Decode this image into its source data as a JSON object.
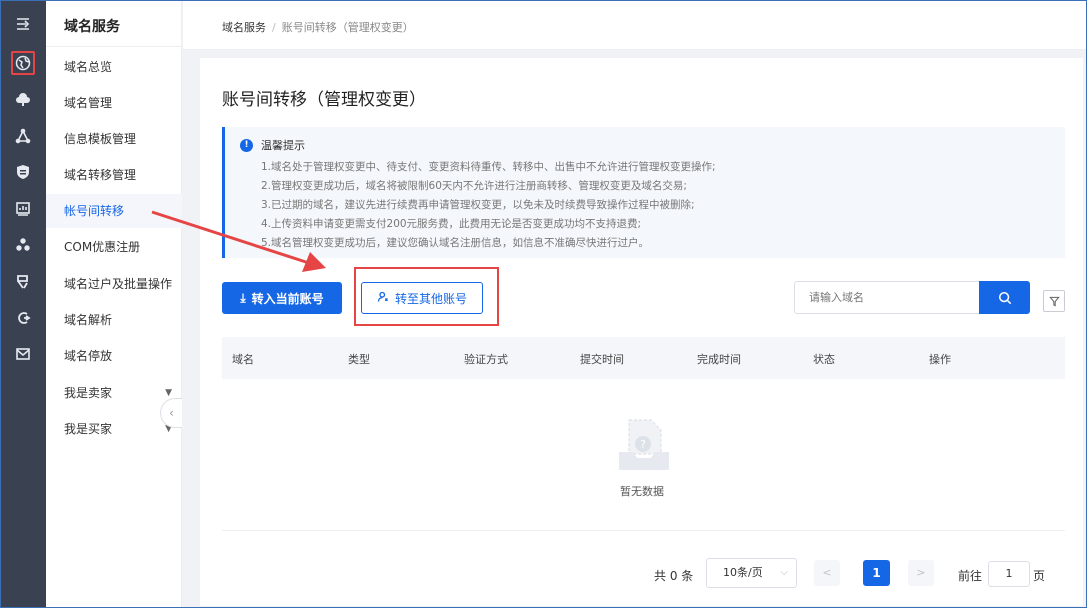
{
  "colors": {
    "rail_bg": "#3a4251",
    "accent": "#1667e6",
    "annotation": "#e64545"
  },
  "rail": {
    "icons": [
      "menu-expand-icon",
      "domain-globe-icon",
      "cloud-icon",
      "network-icon",
      "shield-icon",
      "monitor-icon",
      "cluster-icon",
      "server-icon",
      "cdn-icon",
      "mail-icon"
    ]
  },
  "sidebar": {
    "title": "域名服务",
    "items": [
      {
        "label": "域名总览"
      },
      {
        "label": "域名管理"
      },
      {
        "label": "信息模板管理"
      },
      {
        "label": "域名转移管理"
      },
      {
        "label": "帐号间转移"
      },
      {
        "label": "COM优惠注册"
      },
      {
        "label": "域名过户及批量操作"
      },
      {
        "label": "域名解析"
      },
      {
        "label": "域名停放"
      },
      {
        "label": "我是卖家"
      },
      {
        "label": "我是买家"
      }
    ],
    "collapse_glyph": "‹"
  },
  "breadcrumb": {
    "root": "域名服务",
    "sep": "/",
    "current": "账号间转移（管理权变更）"
  },
  "main": {
    "title": "账号间转移（管理权变更）",
    "notice": {
      "icon": "!",
      "heading": "温馨提示",
      "lines": [
        "1.域名处于管理权变更中、待支付、变更资料待重传、转移中、出售中不允许进行管理权变更操作;",
        "2.管理权变更成功后，域名将被限制60天内不允许进行注册商转移、管理权变更及域名交易;",
        "3.已过期的域名，建议先进行续费再申请管理权变更，以免未及时续费导致操作过程中被删除;",
        "4.上传资料申请变更需支付200元服务费，此费用无论是否变更成功均不支持退费;",
        "5.域名管理权变更成功后，建议您确认域名注册信息，如信息不准确尽快进行过户。"
      ]
    },
    "btn_transfer_in": "转入当前账号",
    "btn_transfer_out": "转至其他账号",
    "search_placeholder": "请输入域名",
    "table": {
      "columns": [
        "域名",
        "类型",
        "验证方式",
        "提交时间",
        "完成时间",
        "状态",
        "操作"
      ],
      "empty_text": "暂无数据"
    },
    "pagination": {
      "total": "共 0 条",
      "page_size": "10条/页",
      "prev": "<",
      "current": "1",
      "next": ">",
      "goto_label": "前往",
      "goto_value": "1",
      "goto_suffix": "页"
    }
  }
}
